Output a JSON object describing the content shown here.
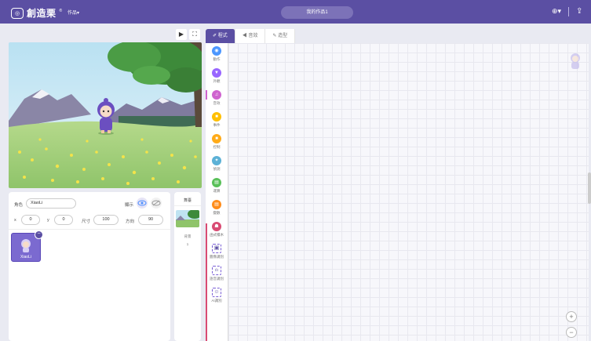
{
  "topbar": {
    "logo_glyph": "◎",
    "logo_text": "創造栗",
    "logo_mark": "®",
    "works_menu": "作品▾",
    "project_title": "我的作品1",
    "lang_icon": "⊕▾",
    "save_icon": "⇪"
  },
  "stage_controls": {
    "play": "▶",
    "fullscreen": "⛶"
  },
  "sprite_info": {
    "role_label": "角色",
    "role_value": "XiaoLi",
    "show_label": "顯示",
    "x_label": "x",
    "x_value": "0",
    "y_label": "y",
    "y_value": "0",
    "size_label": "尺寸",
    "size_value": "100",
    "direction_label": "方向",
    "direction_value": "90"
  },
  "sprites": [
    {
      "name": "XiaoLi"
    }
  ],
  "backdrop_panel": {
    "title": "舞臺",
    "label": "背景",
    "count": "1"
  },
  "tabs": [
    {
      "label": "✐ 程式",
      "active": true
    },
    {
      "label": "◀ 音效",
      "active": false
    },
    {
      "label": "✎ 造型",
      "active": false
    }
  ],
  "categories": [
    {
      "label": "動作",
      "color": "#4c97ff",
      "glyph": "◉"
    },
    {
      "label": "外觀",
      "color": "#9966ff",
      "glyph": "▼"
    },
    {
      "label": "音效",
      "color": "#cf63cf",
      "glyph": "♫"
    },
    {
      "label": "事件",
      "color": "#ffbf00",
      "glyph": "■"
    },
    {
      "label": "控制",
      "color": "#ffab19",
      "glyph": "■"
    },
    {
      "label": "偵測",
      "color": "#5cb1d6",
      "glyph": "✦"
    },
    {
      "label": "運算",
      "color": "#59c059",
      "glyph": "▤"
    },
    {
      "label": "變數",
      "color": "#ff8c1a",
      "glyph": "▤"
    },
    {
      "label": "函式積木",
      "color": "#d94b73",
      "glyph": "☗"
    }
  ],
  "extensions": [
    {
      "label": "圖像識別",
      "glyph": "▣"
    },
    {
      "label": "語音識別",
      "glyph": "ılı"
    },
    {
      "label": "AI識別",
      "glyph": "☺"
    }
  ],
  "zoom": {
    "in": "+",
    "out": "−"
  }
}
